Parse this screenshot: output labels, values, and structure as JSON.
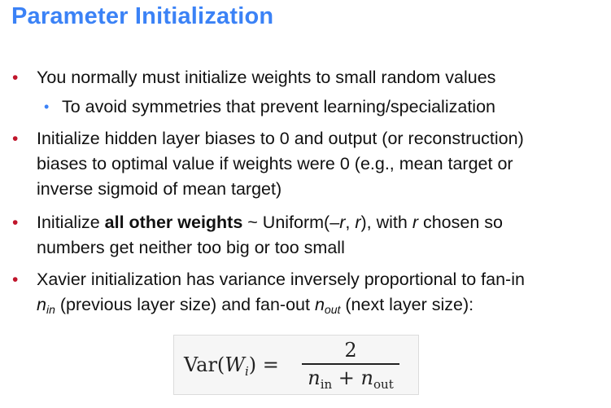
{
  "title": "Parameter Initialization",
  "bullets": {
    "b1": {
      "text": "You normally must initialize weights to small random values"
    },
    "b1_sub": {
      "text": "To avoid symmetries that prevent learning/specialization"
    },
    "b2": {
      "line1": "Initialize hidden layer biases to 0 and output (or reconstruction)",
      "line2": "biases to optimal value if weights were 0 (e.g., mean target or",
      "line3": "inverse sigmoid of mean target)"
    },
    "b3": {
      "prefix": "Initialize ",
      "bold": "all other weights",
      "mid": " ~ Uniform(–",
      "r1": "r",
      "comma": ", ",
      "r2": "r",
      "mid2": "), with ",
      "r3": "r",
      "suffix": " chosen so",
      "line2": "numbers get neither too big or too small"
    },
    "b4": {
      "line1": "Xavier initialization has variance inversely proportional to fan-in",
      "n_in": "n",
      "n_in_sub": "in",
      "mid": " (previous layer size) and fan-out ",
      "n_out": "n",
      "n_out_sub": "out",
      "suffix": " (next layer size):"
    }
  },
  "formula": {
    "lhs_var": "Var(",
    "lhs_w": "W",
    "lhs_sub": "i",
    "lhs_close": ")",
    "equals": " = ",
    "numerator": "2",
    "den_n1": "n",
    "den_sub1": "in",
    "den_plus": " + ",
    "den_n2": "n",
    "den_sub2": "out"
  },
  "colors": {
    "title": "#3b82f6",
    "bullet_marker": "#c0152b",
    "sub_bullet_marker": "#3b82f6"
  }
}
